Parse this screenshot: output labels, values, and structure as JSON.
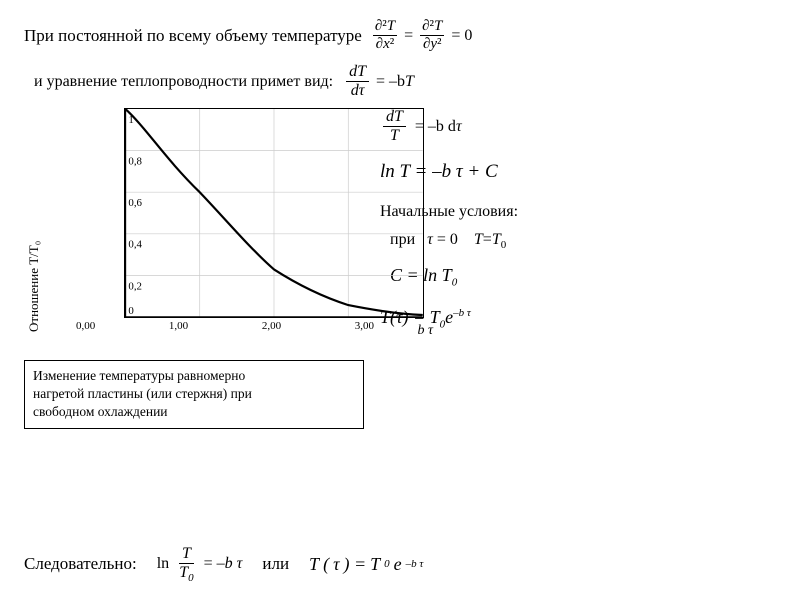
{
  "page": {
    "topText": "При постоянной по  всему  объему  температуре",
    "eq1_num": "∂²T",
    "eq1_den1": "∂x²",
    "eq1_plus": "=",
    "eq1_num2": "∂²T",
    "eq1_den2": "∂y²",
    "eq1_equals": "= 0",
    "secondLine": "и уравнение теплопроводности примет  вид:",
    "eq_dT_num": "dT",
    "eq_dT_den": "dτ",
    "eq_dT_rhs": "= –bT",
    "eq_dT2_num": "dT",
    "eq_dT2_den": "T",
    "eq_dT2_rhs": "= –bd τ",
    "eq_ln": "ln T = –b τ + C",
    "initial_label": "Начальные  условия:",
    "initial_cond": "при   τ = 0   T=T",
    "initial_sub": "0",
    "eq_C": "C = ln T",
    "eq_C_sub": "0",
    "eq_T_tau": "T (τ) = T",
    "eq_T_sub": "0",
    "eq_T_exp": "e",
    "eq_T_exp_sup": "–b τ",
    "bottom_sledovatelno": "Следовательно:",
    "bottom_ln_num": "T",
    "bottom_ln_den": "T",
    "bottom_ln_den_sub": "0",
    "bottom_ln_rhs": "= –b τ",
    "bottom_ili": "или",
    "chartYLabel": "Отношение T/T₀",
    "chartXLabel": "b τ",
    "xAxisValues": [
      "0,00",
      "1,00",
      "2,00",
      "3,00"
    ],
    "yAxisValues": [
      "0",
      "0,2",
      "0,4",
      "0,6",
      "0,8",
      "1"
    ],
    "captionLine1": "Изменение  температуры  равномерно",
    "captionLine2": "нагретой  пластины  (или  стержня)  при",
    "captionLine3": "свободном   охлаждении"
  }
}
